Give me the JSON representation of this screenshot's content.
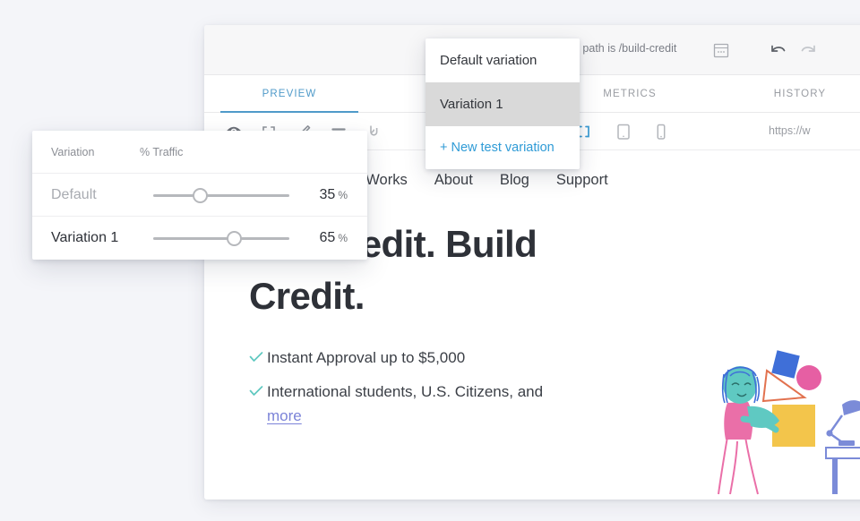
{
  "background_color": "#f4f5f9",
  "accent_color": "#4f9ac9",
  "link_color": "#2f9bd6",
  "app": {
    "topbar": {
      "url_path_text": "rl path is /build-credit",
      "calendar_icon": "calendar-icon",
      "undo_icon": "undo-icon",
      "redo_icon": "redo-icon"
    },
    "tabs": [
      {
        "label": "PREVIEW",
        "active": true
      },
      {
        "label": "",
        "active": false
      },
      {
        "label": "METRICS",
        "active": false
      },
      {
        "label": "HISTORY",
        "active": false
      }
    ],
    "toolbar": {
      "icons": [
        "eye-icon",
        "select-frame-icon",
        "pencil-icon",
        "text-lines-icon",
        "mask-icon",
        "desktop-icon",
        "tablet-icon",
        "mobile-icon"
      ],
      "url_value": "https://w"
    }
  },
  "dropdown": {
    "items": [
      {
        "label": "Default variation",
        "selected": false,
        "is_new": false
      },
      {
        "label": "Variation 1",
        "selected": true,
        "is_new": false
      },
      {
        "label": "+ New test variation",
        "selected": false,
        "is_new": true
      }
    ]
  },
  "traffic_panel": {
    "headers": {
      "variation": "Variation",
      "percent": "% Traffic"
    },
    "rows": [
      {
        "name": "Default",
        "value": "35",
        "unit": "%",
        "muted": true,
        "thumb_pct": 35
      },
      {
        "name": "Variation 1",
        "value": "65",
        "unit": "%",
        "muted": false,
        "thumb_pct": 65
      }
    ]
  },
  "preview_page": {
    "nav": [
      "w It Works",
      "About",
      "Blog",
      "Support"
    ],
    "headline": "Get Credit. Build Credit.",
    "bullets": [
      {
        "text": "Instant Approval up to $5,000",
        "link": ""
      },
      {
        "text": "International students, U.S. Citizens, and",
        "link": "more"
      }
    ],
    "illustration": "person-with-shapes-illustration"
  }
}
